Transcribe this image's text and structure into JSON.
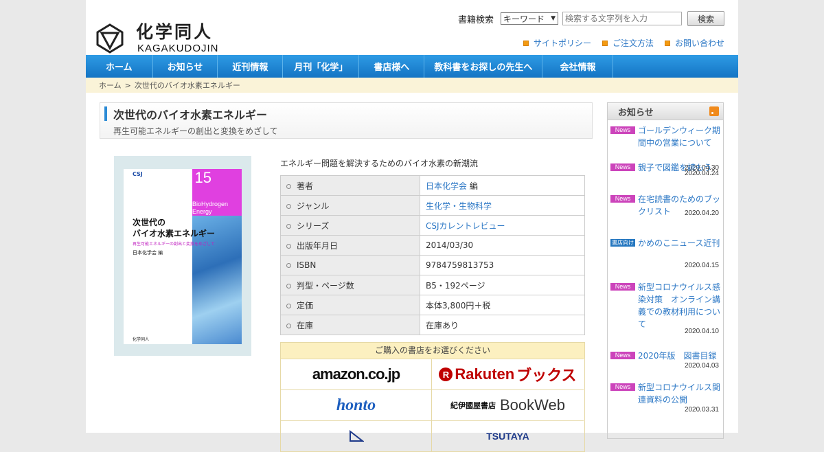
{
  "header": {
    "logo_jp": "化学同人",
    "logo_en": "KAGAKUDOJIN",
    "search_label": "書籍検索",
    "search_select": "キーワード",
    "search_placeholder": "検索する文字列を入力",
    "search_button": "検索",
    "util_links": [
      "サイトポリシー",
      "ご注文方法",
      "お問い合わせ"
    ]
  },
  "nav": [
    "ホーム",
    "お知らせ",
    "近刊情報",
    "月刊「化学」",
    "書店様へ",
    "教科書をお探しの先生へ",
    "会社情報"
  ],
  "breadcrumb": {
    "home": "ホーム",
    "sep": ">",
    "current": "次世代のバイオ水素エネルギー"
  },
  "book": {
    "title": "次世代のバイオ水素エネルギー",
    "subtitle": "再生可能エネルギーの創出と変換をめざして",
    "lead": "エネルギー問題を解決するためのバイオ水素の新潮流",
    "cover": {
      "series_mark": "CSJ",
      "number": "15",
      "english": "BioHydrogen Energy",
      "title_line1": "次世代の",
      "title_line2": "バイオ水素エネルギー",
      "sub": "再生可能エネルギーの創出と変換をめざして",
      "author": "日本化学会 編",
      "publisher": "化学同人"
    },
    "specs": [
      {
        "key": "著者",
        "value": "日本化学会",
        "suffix": " 編",
        "link": true
      },
      {
        "key": "ジャンル",
        "value": "生化学・生物科学",
        "suffix": "",
        "link": true
      },
      {
        "key": "シリーズ",
        "value": "CSJカレントレビュー",
        "suffix": "",
        "link": true
      },
      {
        "key": "出版年月日",
        "value": "2014/03/30",
        "suffix": "",
        "link": false
      },
      {
        "key": "ISBN",
        "value": "9784759813753",
        "suffix": "",
        "link": false
      },
      {
        "key": "判型・ページ数",
        "value": "B5・192ページ",
        "suffix": "",
        "link": false
      },
      {
        "key": "定価",
        "value": "本体3,800円＋税",
        "suffix": "",
        "link": false
      },
      {
        "key": "在庫",
        "value": "在庫あり",
        "suffix": "",
        "link": false
      }
    ]
  },
  "buy": {
    "heading": "ご購入の書店をお選びください",
    "stores": {
      "amazon": "amazon.co.jp",
      "rakuten_mark": "R",
      "rakuten": "Rakuten",
      "rakuten_books": "ブックス",
      "honto": "honto",
      "kinokuniya": "紀伊國屋書店",
      "bookweb": "BookWeb",
      "tsutaya": "TSUTAYA"
    }
  },
  "sidebar": {
    "title": "お知らせ",
    "news": [
      {
        "tag": "News",
        "title": "ゴールデンウィーク期間中の営業について",
        "date": "2020.04.30"
      },
      {
        "tag": "News",
        "title": "親子で図鑑を読もう",
        "date": "2020.04.24"
      },
      {
        "tag": "News",
        "title": "在宅読書のためのブックリスト",
        "date": "2020.04.20"
      },
      {
        "tag": "書店向け",
        "title": "かめのこニュース近刊",
        "date": "2020.04.15"
      },
      {
        "tag": "News",
        "title": "新型コロナウイルス感染対策　オンライン講義での教材利用について",
        "date": "2020.04.10"
      },
      {
        "tag": "News",
        "title": "2020年版　図書目録",
        "date": "2020.04.03"
      },
      {
        "tag": "News",
        "title": "新型コロナウイルス関連資料の公開",
        "date": "2020.03.31"
      }
    ]
  },
  "colors": {
    "nav": "#1e88d8",
    "link": "#2b77c5",
    "news_tag": "#cc44bb",
    "store_tag": "#2577c0"
  }
}
